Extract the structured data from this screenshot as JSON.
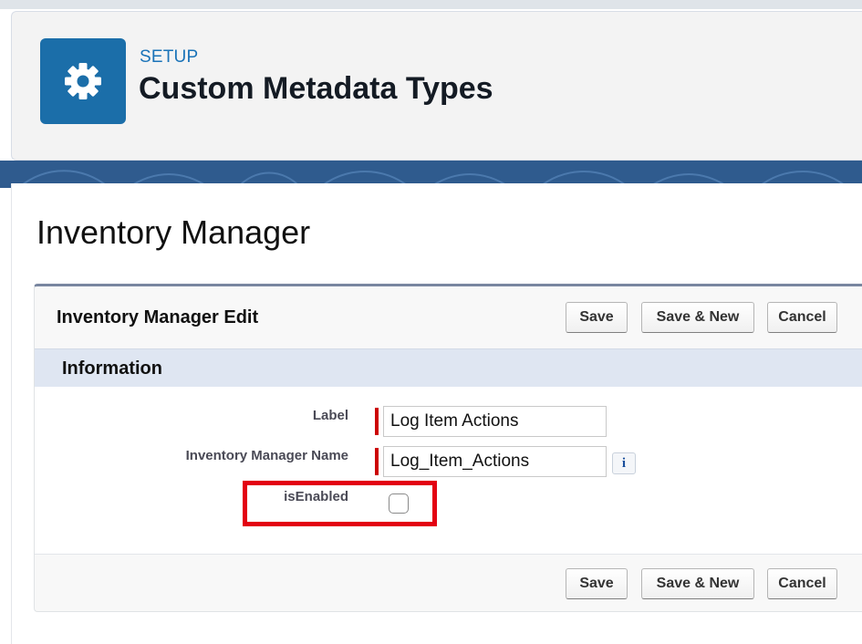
{
  "header": {
    "eyebrow": "SETUP",
    "title": "Custom Metadata Types",
    "icon": "gear-icon"
  },
  "record": {
    "title": "Inventory Manager"
  },
  "panel": {
    "title": "Inventory Manager Edit",
    "section_title": "Information",
    "buttons": {
      "save": "Save",
      "save_new": "Save & New",
      "cancel": "Cancel"
    }
  },
  "fields": {
    "label": {
      "label": "Label",
      "value": "Log Item Actions"
    },
    "name": {
      "label": "Inventory Manager Name",
      "value": "Log_Item_Actions",
      "info": "i"
    },
    "is_enabled": {
      "label": "isEnabled",
      "checked": false
    }
  },
  "colors": {
    "icon_bg": "#1b6ea9",
    "eyebrow": "#1a73b8",
    "section_bar": "#dfe6f2",
    "required": "#cc0000",
    "highlight": "#e30012"
  }
}
